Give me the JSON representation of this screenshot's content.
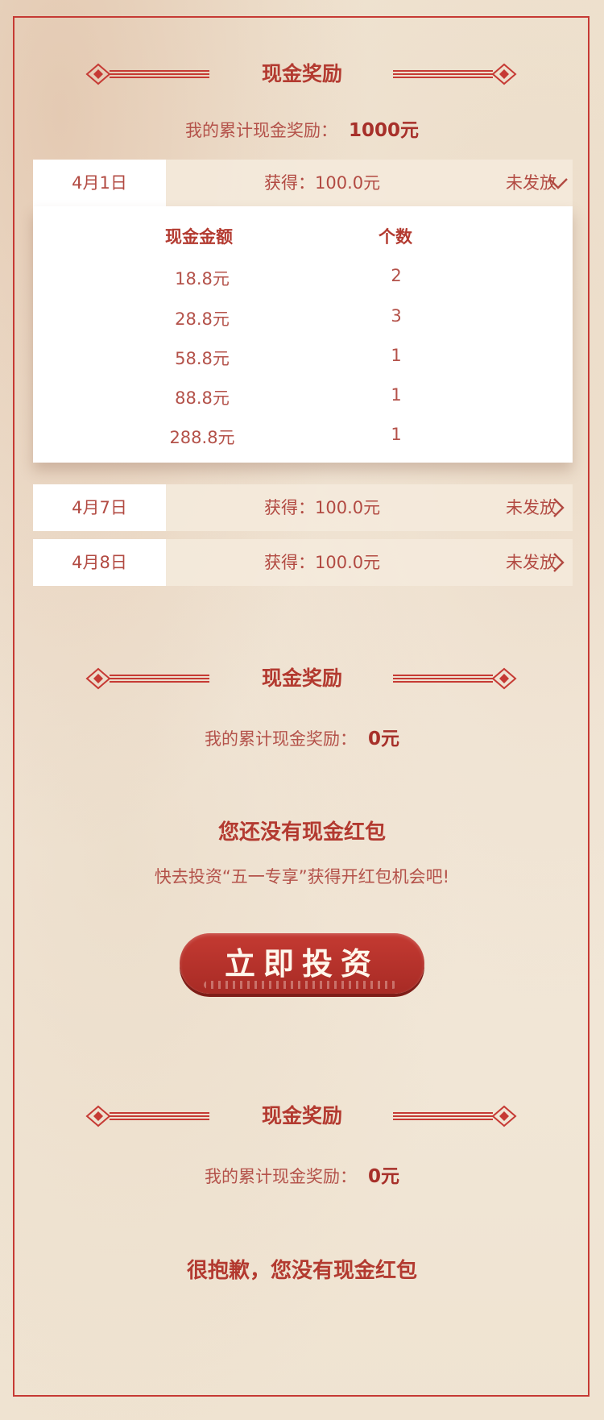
{
  "colors": {
    "accent": "#b33a30",
    "frame": "#c63a34",
    "button": "#b8322b",
    "background": "#f1e6d6"
  },
  "section1": {
    "title": "现金奖励",
    "total_label": "我的累计现金奖励：",
    "total_value": "1000元",
    "rows": [
      {
        "date": "4月1日",
        "got": "获得：100.0元",
        "status": "未发放",
        "icon": "chevron-down-icon",
        "expanded": true
      },
      {
        "date": "4月7日",
        "got": "获得：100.0元",
        "status": "未发放",
        "icon": "chevron-right-icon",
        "expanded": false
      },
      {
        "date": "4月8日",
        "got": "获得：100.0元",
        "status": "未发放",
        "icon": "chevron-right-icon",
        "expanded": false
      }
    ],
    "detail": {
      "col_amount": "现金金额",
      "col_count": "个数",
      "items": [
        {
          "amount": "18.8元",
          "count": "2"
        },
        {
          "amount": "28.8元",
          "count": "3"
        },
        {
          "amount": "58.8元",
          "count": "1"
        },
        {
          "amount": "88.8元",
          "count": "1"
        },
        {
          "amount": "288.8元",
          "count": "1"
        }
      ]
    }
  },
  "section2": {
    "title": "现金奖励",
    "total_label": "我的累计现金奖励：",
    "total_value": "0元",
    "empty_title": "您还没有现金红包",
    "empty_sub": "快去投资“五一专享”获得开红包机会吧!",
    "button_label": "立即投资"
  },
  "section3": {
    "title": "现金奖励",
    "total_label": "我的累计现金奖励：",
    "total_value": "0元",
    "empty_title": "很抱歉，您没有现金红包"
  }
}
